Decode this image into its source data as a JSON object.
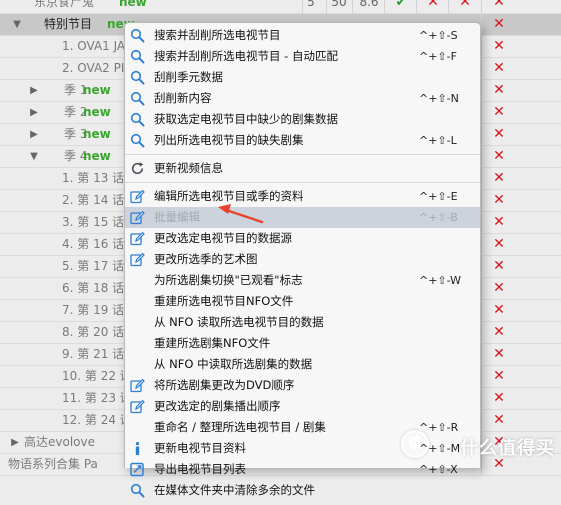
{
  "tree": {
    "rows": [
      {
        "indent": 2,
        "arrow": "",
        "name": "东京食尸鬼",
        "new": "new",
        "sel": false,
        "cells": [
          {
            "t": "5"
          },
          {
            "t": "50"
          },
          {
            "t": "8.6"
          },
          {
            "t": "✔",
            "k": "check"
          },
          {
            "t": "✕",
            "k": "x"
          },
          {
            "t": "✕",
            "k": "x"
          },
          {
            "t": "✕",
            "k": "x"
          }
        ]
      },
      {
        "indent": 1,
        "arrow": "▼",
        "name": "特别节目",
        "new": "new",
        "sel": true,
        "cells": [
          {
            "t": "✕",
            "k": "x"
          }
        ]
      },
      {
        "indent": 3,
        "arrow": "",
        "name": "1. OVA1 JA",
        "new": "",
        "sel": false,
        "cells": [
          {
            "t": "✕",
            "k": "x"
          }
        ]
      },
      {
        "indent": 3,
        "arrow": "",
        "name": "2. OVA2 PI",
        "new": "",
        "sel": false,
        "cells": [
          {
            "t": "✕",
            "k": "x"
          }
        ]
      },
      {
        "indent": 2,
        "arrow": "▶",
        "name": "季 1",
        "new": "new",
        "sel": false,
        "cells": [
          {
            "t": "✕",
            "k": "x"
          }
        ]
      },
      {
        "indent": 2,
        "arrow": "▶",
        "name": "季 2",
        "new": "new",
        "sel": false,
        "cells": [
          {
            "t": "✕",
            "k": "x"
          }
        ]
      },
      {
        "indent": 2,
        "arrow": "▶",
        "name": "季 3",
        "new": "new",
        "sel": false,
        "cells": [
          {
            "t": "✕",
            "k": "x"
          }
        ]
      },
      {
        "indent": 2,
        "arrow": "▼",
        "name": "季 4",
        "new": "new",
        "sel": false,
        "cells": [
          {
            "t": "✕",
            "k": "x"
          }
        ]
      },
      {
        "indent": 3,
        "arrow": "",
        "name": "1. 第 13 话",
        "new": "",
        "sel": false,
        "cells": [
          {
            "t": "✕",
            "k": "x"
          }
        ]
      },
      {
        "indent": 3,
        "arrow": "",
        "name": "2. 第 14 话",
        "new": "",
        "sel": false,
        "cells": [
          {
            "t": "✕",
            "k": "x"
          }
        ]
      },
      {
        "indent": 3,
        "arrow": "",
        "name": "3. 第 15 话",
        "new": "",
        "sel": false,
        "cells": [
          {
            "t": "✕",
            "k": "x"
          }
        ]
      },
      {
        "indent": 3,
        "arrow": "",
        "name": "4. 第 16 话",
        "new": "",
        "sel": false,
        "cells": [
          {
            "t": "✕",
            "k": "x"
          }
        ]
      },
      {
        "indent": 3,
        "arrow": "",
        "name": "5. 第 17 话",
        "new": "",
        "sel": false,
        "cells": [
          {
            "t": "✕",
            "k": "x"
          }
        ]
      },
      {
        "indent": 3,
        "arrow": "",
        "name": "6. 第 18 话",
        "new": "",
        "sel": false,
        "cells": [
          {
            "t": "✕",
            "k": "x"
          }
        ]
      },
      {
        "indent": 3,
        "arrow": "",
        "name": "7. 第 19 话",
        "new": "",
        "sel": false,
        "cells": [
          {
            "t": "✕",
            "k": "x"
          }
        ]
      },
      {
        "indent": 3,
        "arrow": "",
        "name": "8. 第 20 话",
        "new": "",
        "sel": false,
        "cells": [
          {
            "t": "✕",
            "k": "x"
          }
        ]
      },
      {
        "indent": 3,
        "arrow": "",
        "name": "9. 第 21 话",
        "new": "",
        "sel": false,
        "cells": [
          {
            "t": "✕",
            "k": "x"
          }
        ]
      },
      {
        "indent": 3,
        "arrow": "",
        "name": "10. 第 22 话",
        "new": "",
        "sel": false,
        "cells": [
          {
            "t": "✕",
            "k": "x"
          }
        ]
      },
      {
        "indent": 3,
        "arrow": "",
        "name": "11. 第 23 话",
        "new": "",
        "sel": false,
        "cells": [
          {
            "t": "✕",
            "k": "x"
          }
        ]
      },
      {
        "indent": 3,
        "arrow": "",
        "name": "12. 第 24 话",
        "new": "",
        "sel": false,
        "cells": [
          {
            "t": "✕",
            "k": "x"
          }
        ]
      },
      {
        "indent": 0,
        "arrow": "▶",
        "name": "高达evolove",
        "new": "",
        "sel": false,
        "cells": [
          {
            "t": "✕",
            "k": "x"
          }
        ]
      },
      {
        "indent": 0,
        "arrow": "",
        "name": "物语系列合集 Pa",
        "new": "",
        "sel": false,
        "cells": [
          {
            "t": "✕",
            "k": "x"
          }
        ]
      }
    ]
  },
  "menu": {
    "items": [
      {
        "type": "item",
        "icon": "search",
        "label": "搜索并刮削所选电视节目",
        "shortcut": "^+⇧-S"
      },
      {
        "type": "item",
        "icon": "search",
        "label": "搜索并刮削所选电视节目 - 自动匹配",
        "shortcut": "^+⇧-F"
      },
      {
        "type": "item",
        "icon": "search",
        "label": "刮削季元数据",
        "shortcut": ""
      },
      {
        "type": "item",
        "icon": "search",
        "label": "刮削新内容",
        "shortcut": "^+⇧-N"
      },
      {
        "type": "item",
        "icon": "search",
        "label": "获取选定电视节目中缺少的剧集数据",
        "shortcut": ""
      },
      {
        "type": "item",
        "icon": "search",
        "label": "列出所选电视节目的缺失剧集",
        "shortcut": "^+⇧-L"
      },
      {
        "type": "sep"
      },
      {
        "type": "item",
        "icon": "refresh",
        "label": "更新视频信息",
        "shortcut": ""
      },
      {
        "type": "sep"
      },
      {
        "type": "item",
        "icon": "edit",
        "label": "编辑所选电视节目或季的资料",
        "shortcut": "^+⇧-E"
      },
      {
        "type": "item",
        "icon": "edit",
        "label": "批量编辑",
        "shortcut": "^+⇧-B",
        "highlight": true,
        "disabled": true
      },
      {
        "type": "item",
        "icon": "edit",
        "label": "更改选定电视节目的数据源",
        "shortcut": ""
      },
      {
        "type": "item",
        "icon": "edit",
        "label": "更改所选季的艺术图",
        "shortcut": ""
      },
      {
        "type": "item",
        "icon": "",
        "label": "为所选剧集切换\"已观看\"标志",
        "shortcut": "^+⇧-W"
      },
      {
        "type": "item",
        "icon": "",
        "label": "重建所选电视节目NFO文件",
        "shortcut": ""
      },
      {
        "type": "item",
        "icon": "",
        "label": "从 NFO 读取所选电视节目的数据",
        "shortcut": ""
      },
      {
        "type": "item",
        "icon": "",
        "label": "重建所选剧集NFO文件",
        "shortcut": ""
      },
      {
        "type": "item",
        "icon": "",
        "label": "从 NFO 中读取所选剧集的数据",
        "shortcut": ""
      },
      {
        "type": "item",
        "icon": "edit",
        "label": "将所选剧集更改为DVD顺序",
        "shortcut": ""
      },
      {
        "type": "item",
        "icon": "edit",
        "label": "更改选定的剧集播出顺序",
        "shortcut": ""
      },
      {
        "type": "item",
        "icon": "",
        "label": "重命名 / 整理所选电视节目 / 剧集",
        "shortcut": "^+⇧-R"
      },
      {
        "type": "item",
        "icon": "info",
        "label": "更新电视节目资料",
        "shortcut": "^+⇧-M"
      },
      {
        "type": "item",
        "icon": "export",
        "label": "导出电视节目列表",
        "shortcut": "^+⇧-X"
      },
      {
        "type": "item",
        "icon": "search",
        "label": "在媒体文件夹中清除多余的文件",
        "shortcut": ""
      }
    ]
  },
  "watermark": {
    "circle": "值",
    "text": "什么值得买"
  },
  "colors": {
    "accent": "#2d7fd3",
    "new": "#3aa52e",
    "x": "#d9161f",
    "arrow": "#e8432d"
  }
}
